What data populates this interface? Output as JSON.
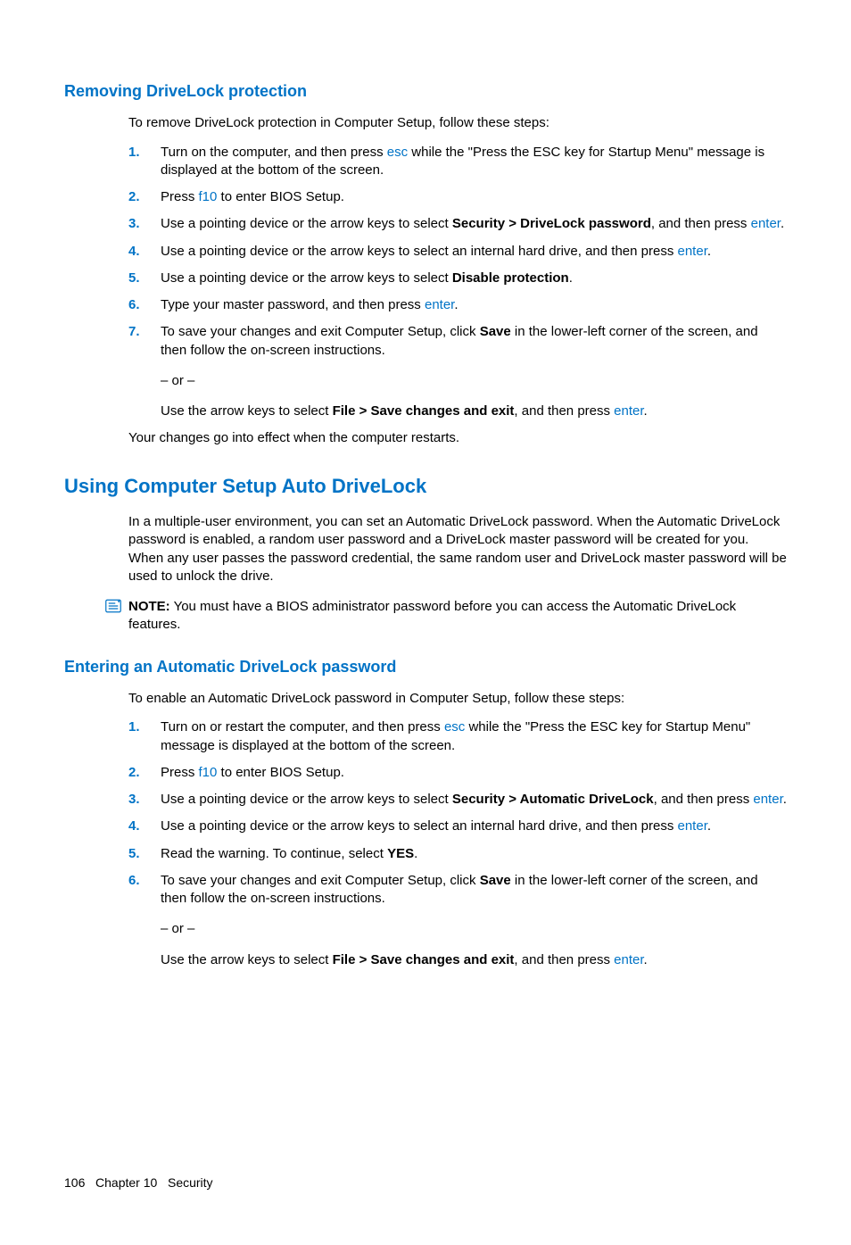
{
  "section1": {
    "heading": "Removing DriveLock protection",
    "intro": "To remove DriveLock protection in Computer Setup, follow these steps:",
    "steps": {
      "s1_a": "Turn on the computer, and then press ",
      "s1_key": "esc",
      "s1_b": " while the \"Press the ESC key for Startup Menu\" message is displayed at the bottom of the screen.",
      "s2_a": "Press ",
      "s2_key": "f10",
      "s2_b": " to enter BIOS Setup.",
      "s3_a": "Use a pointing device or the arrow keys to select ",
      "s3_bold": "Security > DriveLock password",
      "s3_b": ", and then press ",
      "s3_key": "enter",
      "s3_c": ".",
      "s4_a": "Use a pointing device or the arrow keys to select an internal hard drive, and then press ",
      "s4_key": "enter",
      "s4_b": ".",
      "s5_a": "Use a pointing device or the arrow keys to select ",
      "s5_bold": "Disable protection",
      "s5_b": ".",
      "s6_a": "Type your master password, and then press ",
      "s6_key": "enter",
      "s6_b": ".",
      "s7_a": "To save your changes and exit Computer Setup, click ",
      "s7_bold": "Save",
      "s7_b": " in the lower-left corner of the screen, and then follow the on-screen instructions.",
      "s7_or": "– or –",
      "s7_c": "Use the arrow keys to select ",
      "s7_bold2": "File > Save changes and exit",
      "s7_d": ", and then press ",
      "s7_key": "enter",
      "s7_e": "."
    },
    "outro": "Your changes go into effect when the computer restarts."
  },
  "section2": {
    "heading": "Using Computer Setup Auto DriveLock",
    "para": "In a multiple-user environment, you can set an Automatic DriveLock password. When the Automatic DriveLock password is enabled, a random user password and a DriveLock master password will be created for you. When any user passes the password credential, the same random user and DriveLock master password will be used to unlock the drive.",
    "note_label": "NOTE:",
    "note_text": " You must have a BIOS administrator password before you can access the Automatic DriveLock features."
  },
  "section3": {
    "heading": "Entering an Automatic DriveLock password",
    "intro": "To enable an Automatic DriveLock password in Computer Setup, follow these steps:",
    "steps": {
      "s1_a": "Turn on or restart the computer, and then press ",
      "s1_key": "esc",
      "s1_b": " while the \"Press the ESC key for Startup Menu\" message is displayed at the bottom of the screen.",
      "s2_a": "Press ",
      "s2_key": "f10",
      "s2_b": " to enter BIOS Setup.",
      "s3_a": "Use a pointing device or the arrow keys to select ",
      "s3_bold": "Security > Automatic DriveLock",
      "s3_b": ", and then press ",
      "s3_key": "enter",
      "s3_c": ".",
      "s4_a": "Use a pointing device or the arrow keys to select an internal hard drive, and then press ",
      "s4_key": "enter",
      "s4_b": ".",
      "s5_a": "Read the warning. To continue, select ",
      "s5_bold": "YES",
      "s5_b": ".",
      "s6_a": "To save your changes and exit Computer Setup, click ",
      "s6_bold": "Save",
      "s6_b": " in the lower-left corner of the screen, and then follow the on-screen instructions.",
      "s6_or": "– or –",
      "s6_c": "Use the arrow keys to select ",
      "s6_bold2": "File > Save changes and exit",
      "s6_d": ", and then press ",
      "s6_key": "enter",
      "s6_e": "."
    }
  },
  "nums": {
    "n1": "1.",
    "n2": "2.",
    "n3": "3.",
    "n4": "4.",
    "n5": "5.",
    "n6": "6.",
    "n7": "7."
  },
  "footer": {
    "page": "106",
    "chapter": "Chapter 10",
    "title": "Security"
  }
}
